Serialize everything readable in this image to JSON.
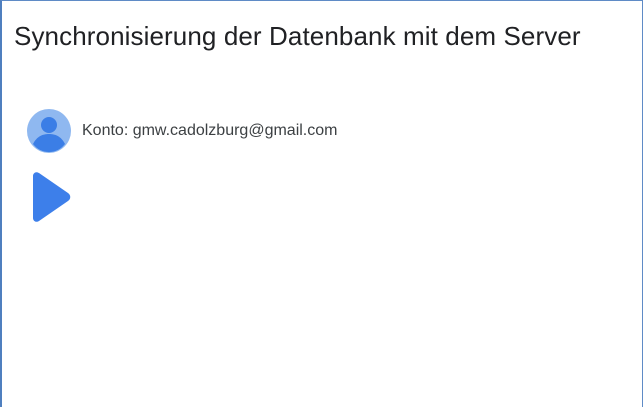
{
  "dialog": {
    "title": "Synchronisierung der Datenbank mit dem Server"
  },
  "account": {
    "label": "Konto: gmw.cadolzburg@gmail.com",
    "avatar_icon": "account-circle-icon",
    "avatar_color": "#4a86e8"
  },
  "controls": {
    "start_icon": "play-icon",
    "accent_color": "#3d7fea"
  }
}
